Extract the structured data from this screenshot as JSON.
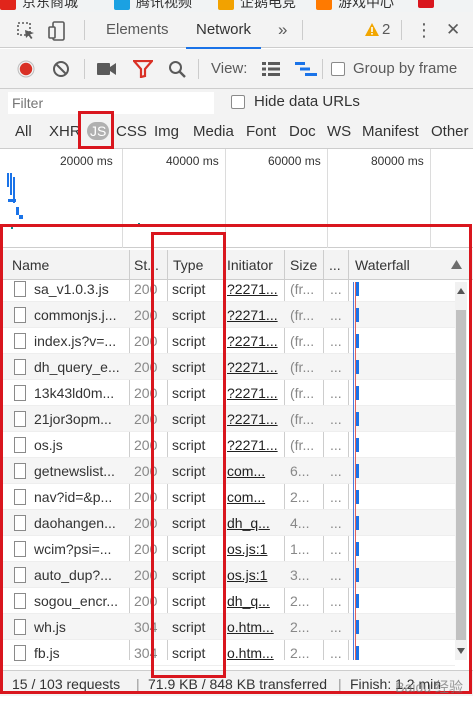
{
  "bookmarks": {
    "items": [
      {
        "label": "京东商城",
        "color": "#e1251b"
      },
      {
        "label": "腾讯视频",
        "color": "#1ba1e2"
      },
      {
        "label": "企鹅电竞",
        "color": "#f2a200"
      },
      {
        "label": "游戏中心",
        "color": "#ff7a00"
      }
    ]
  },
  "devtools": {
    "tabs": [
      {
        "label": "Elements"
      },
      {
        "label": "Network",
        "active": true
      }
    ],
    "more_tabs": "»",
    "warning_count": "2",
    "menu": "⋮",
    "close": "✕"
  },
  "toolbar": {
    "record_color": "#d93025",
    "filter_color": "#d93025",
    "view_label": "View:",
    "group_by_frame": "Group by frame"
  },
  "filter": {
    "placeholder": "Filter",
    "hide_data_urls": "Hide data URLs"
  },
  "types": [
    "All",
    "XHR",
    "JS",
    "CSS",
    "Img",
    "Media",
    "Font",
    "Doc",
    "WS",
    "Manifest",
    "Other"
  ],
  "active_type": "JS",
  "overview": {
    "ticks": [
      "20000 ms",
      "40000 ms",
      "60000 ms",
      "80000 ms"
    ]
  },
  "table": {
    "columns": {
      "name": "Name",
      "status": "St...",
      "type": "Type",
      "initiator": "Initiator",
      "size": "Size",
      "time": "...",
      "waterfall": "Waterfall"
    },
    "rows": [
      {
        "name": "sa_v1.0.3.js",
        "status": "200",
        "type": "script",
        "initiator": "?2271...",
        "size": "(fr...",
        "time": "..."
      },
      {
        "name": "commonjs.j...",
        "status": "200",
        "type": "script",
        "initiator": "?2271...",
        "size": "(fr...",
        "time": "..."
      },
      {
        "name": "index.js?v=...",
        "status": "200",
        "type": "script",
        "initiator": "?2271...",
        "size": "(fr...",
        "time": "..."
      },
      {
        "name": "dh_query_e...",
        "status": "200",
        "type": "script",
        "initiator": "?2271...",
        "size": "(fr...",
        "time": "..."
      },
      {
        "name": "13k43ld0m...",
        "status": "200",
        "type": "script",
        "initiator": "?2271...",
        "size": "(fr...",
        "time": "..."
      },
      {
        "name": "21jor3opm...",
        "status": "200",
        "type": "script",
        "initiator": "?2271...",
        "size": "(fr...",
        "time": "..."
      },
      {
        "name": "os.js",
        "status": "200",
        "type": "script",
        "initiator": "?2271...",
        "size": "(fr...",
        "time": "..."
      },
      {
        "name": "getnewslist...",
        "status": "200",
        "type": "script",
        "initiator": "com...",
        "size": "6...",
        "time": "..."
      },
      {
        "name": "nav?id=&p...",
        "status": "200",
        "type": "script",
        "initiator": "com...",
        "size": "2...",
        "time": "..."
      },
      {
        "name": "daohangen...",
        "status": "200",
        "type": "script",
        "initiator": "dh_q...",
        "size": "4...",
        "time": "..."
      },
      {
        "name": "wcim?psi=...",
        "status": "200",
        "type": "script",
        "initiator": "os.js:1",
        "size": "1...",
        "time": "..."
      },
      {
        "name": "auto_dup?...",
        "status": "200",
        "type": "script",
        "initiator": "os.js:1",
        "size": "3...",
        "time": "..."
      },
      {
        "name": "sogou_encr...",
        "status": "200",
        "type": "script",
        "initiator": "dh_q...",
        "size": "2...",
        "time": "..."
      },
      {
        "name": "wh.js",
        "status": "304",
        "type": "script",
        "initiator": "o.htm...",
        "size": "2...",
        "time": "..."
      },
      {
        "name": "fb.js",
        "status": "304",
        "type": "script",
        "initiator": "o.htm...",
        "size": "2...",
        "time": "..."
      }
    ]
  },
  "status": {
    "requests": "15 / 103 requests",
    "sep": "|",
    "transferred": "71.9 KB / 848 KB transferred",
    "finish": "Finish: 1.2 min"
  },
  "watermark": "Baidu 经验"
}
